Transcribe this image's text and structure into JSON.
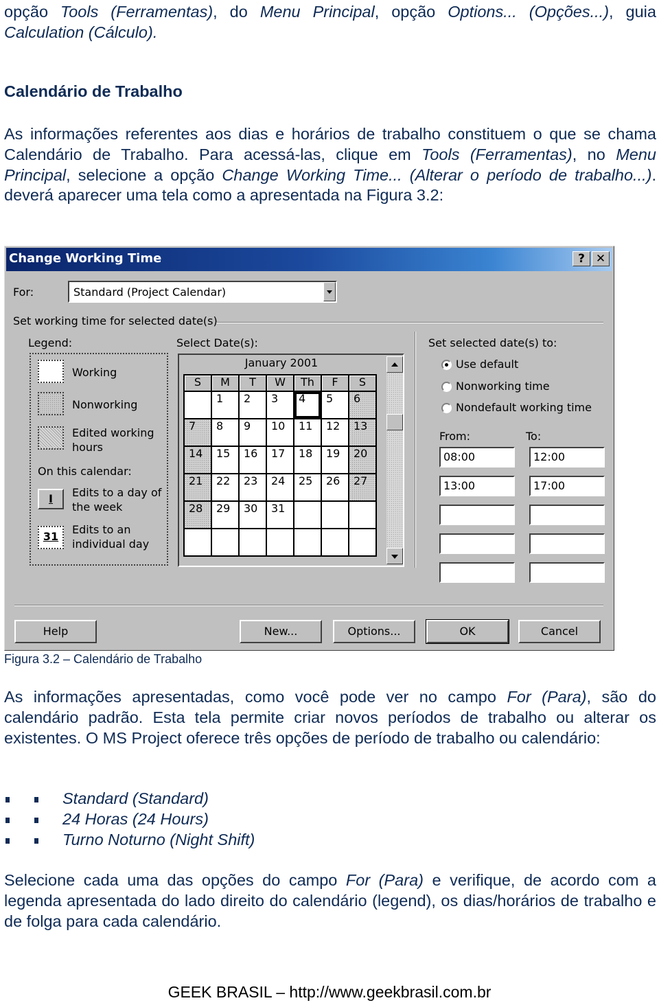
{
  "intro": {
    "line1_parts": [
      "opção ",
      "Tools (Ferramentas)",
      ", do ",
      "Menu Principal",
      ", opção ",
      "Options... (Opções...)",
      ", guia"
    ],
    "line2": "Calculation (Cálculo)."
  },
  "section": {
    "heading": "Calendário de Trabalho",
    "para1": {
      "t1": "As informações referentes aos dias e horários de trabalho constituem o que se chama Calendário de Trabalho. Para acessá-las, clique em ",
      "i1": "Tools (Ferramentas)",
      "t2": ", no ",
      "i2": "Menu Principal",
      "t3": ", selecione a opção ",
      "i3": "Change Working Time... (Alterar o período de trabalho...)",
      "t4": ". deverá aparecer uma tela como a apresentada na Figura 3.2:"
    }
  },
  "dialog": {
    "title": "Change Working Time",
    "help_btn": "?",
    "close_btn": "✕",
    "for_label": "For:",
    "for_value": "Standard (Project Calendar)",
    "group_label": "Set working time for selected date(s)",
    "legend": {
      "title": "Legend:",
      "items": [
        {
          "label1": "Working",
          "label2": ""
        },
        {
          "label1": "Nonworking",
          "label2": ""
        },
        {
          "label1": "Edited working",
          "label2": "hours"
        }
      ],
      "on_this_calendar": "On this calendar:",
      "marks": [
        {
          "glyph": "I",
          "label1": "Edits to a day of",
          "label2": "the week"
        },
        {
          "glyph": "31",
          "label1": "Edits to an",
          "label2": "individual day"
        }
      ]
    },
    "calendar": {
      "label": "Select Date(s):",
      "month": "January 2001",
      "weekdays": [
        "S",
        "M",
        "T",
        "W",
        "Th",
        "F",
        "S"
      ],
      "selected_day": "4",
      "weeks": [
        [
          "",
          "1",
          "2",
          "3",
          "4",
          "5",
          "6"
        ],
        [
          "7",
          "8",
          "9",
          "10",
          "11",
          "12",
          "13"
        ],
        [
          "14",
          "15",
          "16",
          "17",
          "18",
          "19",
          "20"
        ],
        [
          "21",
          "22",
          "23",
          "24",
          "25",
          "26",
          "27"
        ],
        [
          "28",
          "29",
          "30",
          "31",
          "",
          "",
          ""
        ],
        [
          "",
          "",
          "",
          "",
          "",
          "",
          ""
        ]
      ],
      "nonworking_mask": [
        [
          0,
          0,
          0,
          0,
          0,
          0,
          1
        ],
        [
          1,
          0,
          0,
          0,
          0,
          0,
          1
        ],
        [
          1,
          0,
          0,
          0,
          0,
          0,
          1
        ],
        [
          1,
          0,
          0,
          0,
          0,
          0,
          1
        ],
        [
          1,
          0,
          0,
          0,
          0,
          0,
          0
        ],
        [
          0,
          0,
          0,
          0,
          0,
          0,
          0
        ]
      ]
    },
    "set_to": {
      "label": "Set selected date(s) to:",
      "options": [
        {
          "label": "Use default",
          "selected": true
        },
        {
          "label": "Nonworking time",
          "selected": false
        },
        {
          "label": "Nondefault working time",
          "selected": false
        }
      ],
      "from_label": "From:",
      "to_label": "To:",
      "rows": [
        {
          "from": "08:00",
          "to": "12:00"
        },
        {
          "from": "13:00",
          "to": "17:00"
        },
        {
          "from": "",
          "to": ""
        },
        {
          "from": "",
          "to": ""
        },
        {
          "from": "",
          "to": ""
        }
      ]
    },
    "buttons": {
      "help": "Help",
      "new": "New...",
      "options": "Options...",
      "ok": "OK",
      "cancel": "Cancel"
    }
  },
  "caption": "Figura 3.2 – Calendário de Trabalho",
  "para2": {
    "t1": "As informações apresentadas, como você pode ver no campo ",
    "i1": "For (Para)",
    "t2": ", são do calendário padrão. Esta tela permite criar novos períodos de trabalho ou alterar os existentes. O MS Project oferece três opções de período de trabalho ou calendário:"
  },
  "calendar_options": [
    "Standard (Standard)",
    "24 Horas (24 Hours)",
    "Turno Noturno (Night Shift)"
  ],
  "para3": {
    "t1": "Selecione cada uma das opções do campo ",
    "i1": "For (Para)",
    "t2": " e verifique, de acordo com a legenda apresentada do lado direito do calendário (legend), os dias/horários de trabalho e de folga para cada calendário."
  },
  "footer": "GEEK BRASIL – http://www.geekbrasil.com.br"
}
